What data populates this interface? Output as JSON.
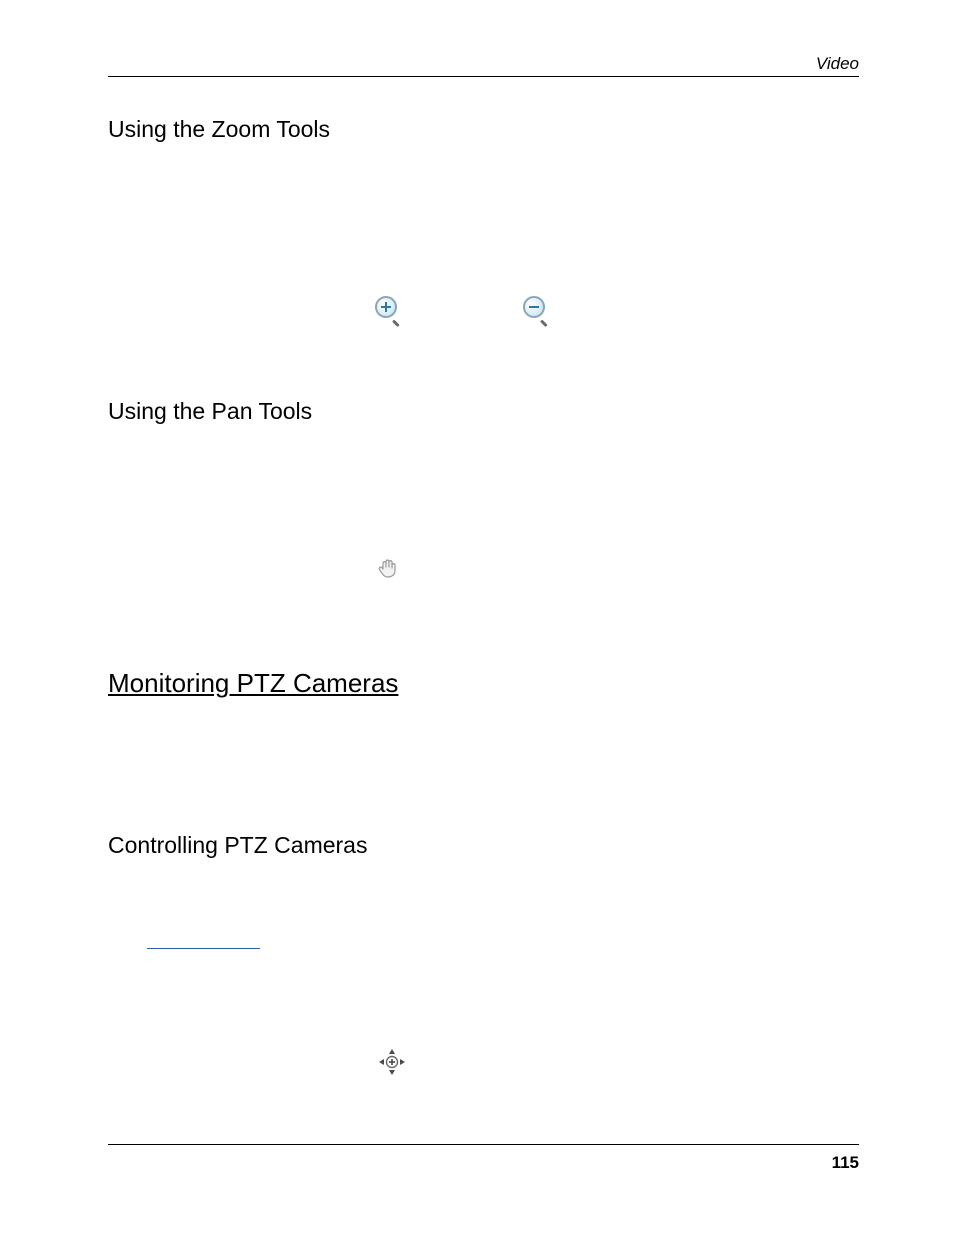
{
  "header": {
    "label": "Video"
  },
  "footer": {
    "page": "115"
  },
  "sections": {
    "zoomHeading": "Using the Zoom Tools",
    "panHeading": "Using the Pan Tools",
    "ptzMonitorHeading": "Monitoring PTZ Cameras",
    "ptzControlHeading": "Controlling PTZ Cameras"
  }
}
